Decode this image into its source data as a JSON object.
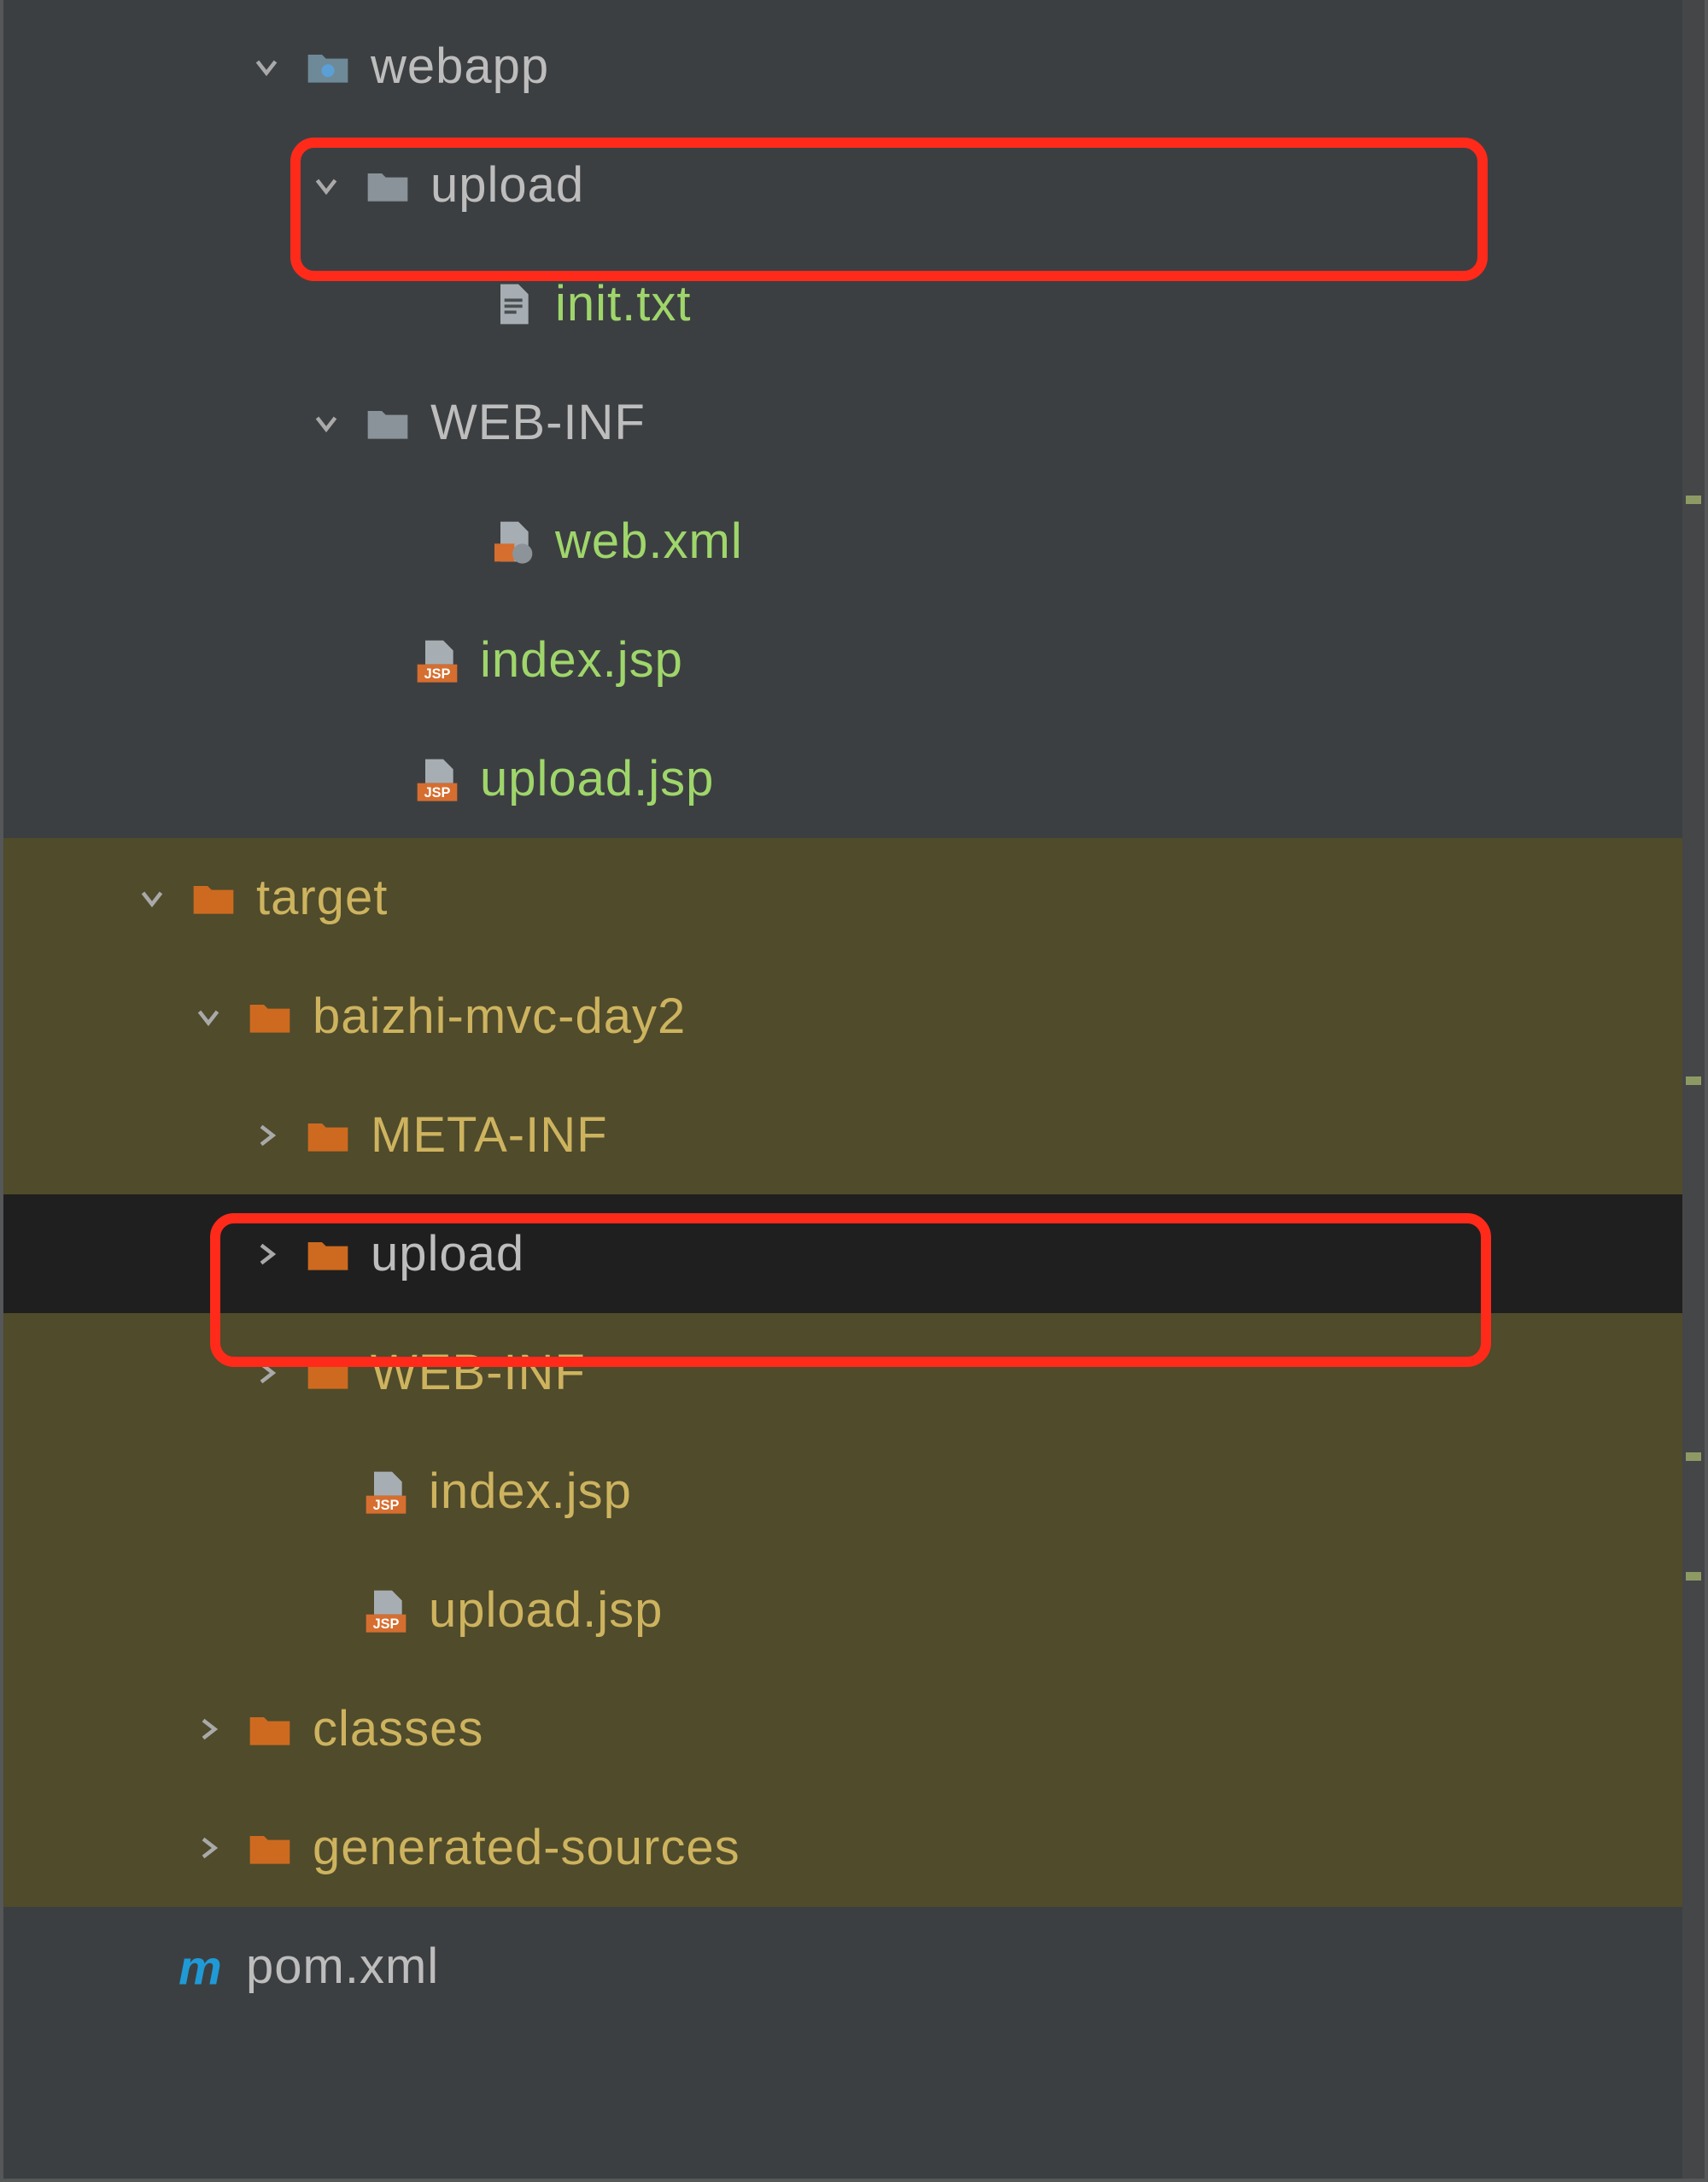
{
  "tree": {
    "webapp": "webapp",
    "upload": "upload",
    "init_txt": "init.txt",
    "web_inf": "WEB-INF",
    "web_xml": "web.xml",
    "index_jsp": "index.jsp",
    "upload_jsp": "upload.jsp",
    "target": "target",
    "baizhi": "baizhi-mvc-day2",
    "meta_inf": "META-INF",
    "t_upload": "upload",
    "t_web_inf": "WEB-INF",
    "t_index_jsp": "index.jsp",
    "t_upload_jsp": "upload.jsp",
    "classes": "classes",
    "gen_sources": "generated-sources",
    "pom": "pom.xml"
  }
}
